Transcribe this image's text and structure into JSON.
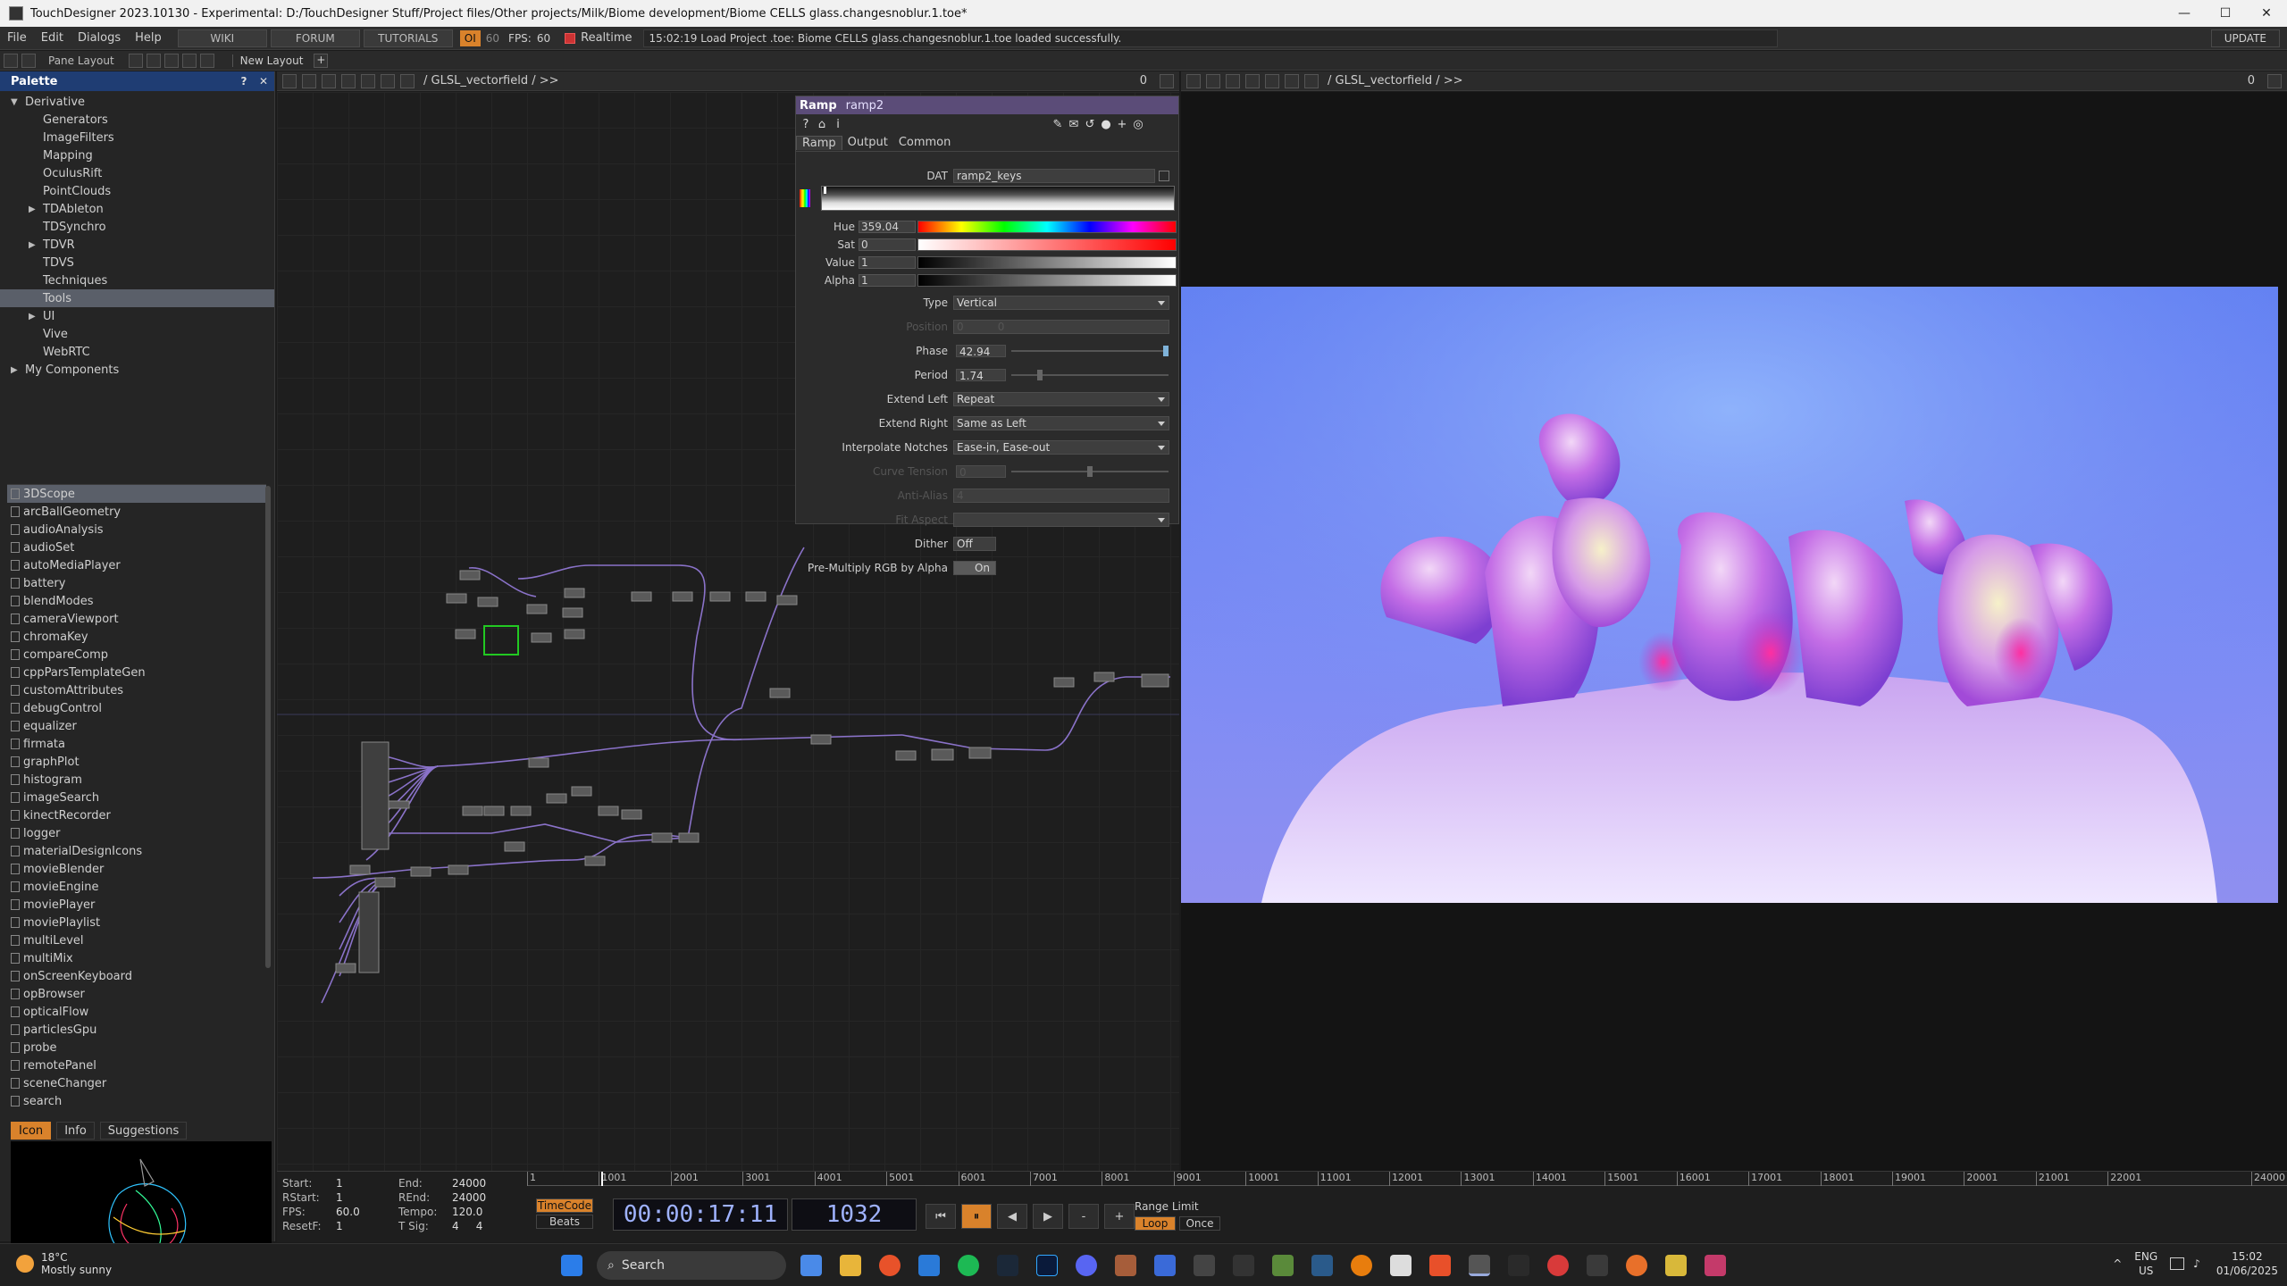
{
  "window": {
    "title": "TouchDesigner 2023.10130 - Experimental: D:/TouchDesigner Stuff/Project files/Other projects/Milk/Biome development/Biome CELLS glass.changesnoblur.1.toe*",
    "minimize": "—",
    "maximize": "☐",
    "close": "✕"
  },
  "menu": {
    "items": [
      "File",
      "Edit",
      "Dialogs",
      "Help"
    ],
    "wiki": "WIKI",
    "forum": "FORUM",
    "tutorials": "TUTORIALS",
    "oi": "OI",
    "fps_small": "60",
    "fps_label": "FPS:",
    "fps_value": "60",
    "realtime": "Realtime",
    "status": "15:02:19 Load Project .toe: Biome CELLS glass.changesnoblur.1.toe loaded successfully.",
    "update": "UPDATE"
  },
  "panebar": {
    "pane_layout": "Pane Layout",
    "new_layout": "New Layout",
    "plus": "+"
  },
  "palette": {
    "title": "Palette",
    "help": "?",
    "close": "✕",
    "tree": [
      {
        "label": "Derivative",
        "indent": 0,
        "arrow": "▼"
      },
      {
        "label": "Generators",
        "indent": 1,
        "arrow": ""
      },
      {
        "label": "ImageFilters",
        "indent": 1,
        "arrow": ""
      },
      {
        "label": "Mapping",
        "indent": 1,
        "arrow": ""
      },
      {
        "label": "OculusRift",
        "indent": 1,
        "arrow": ""
      },
      {
        "label": "PointClouds",
        "indent": 1,
        "arrow": ""
      },
      {
        "label": "TDAbleton",
        "indent": 1,
        "arrow": "▶"
      },
      {
        "label": "TDSynchro",
        "indent": 1,
        "arrow": ""
      },
      {
        "label": "TDVR",
        "indent": 1,
        "arrow": "▶"
      },
      {
        "label": "TDVS",
        "indent": 1,
        "arrow": ""
      },
      {
        "label": "Techniques",
        "indent": 1,
        "arrow": ""
      },
      {
        "label": "Tools",
        "indent": 1,
        "arrow": "",
        "selected": true
      },
      {
        "label": "UI",
        "indent": 1,
        "arrow": "▶"
      },
      {
        "label": "Vive",
        "indent": 1,
        "arrow": ""
      },
      {
        "label": "WebRTC",
        "indent": 1,
        "arrow": ""
      },
      {
        "label": "My Components",
        "indent": 0,
        "arrow": "▶"
      }
    ],
    "tox": [
      "3DScope",
      "arcBallGeometry",
      "audioAnalysis",
      "audioSet",
      "autoMediaPlayer",
      "battery",
      "blendModes",
      "cameraViewport",
      "chromaKey",
      "compareComp",
      "cppParsTemplateGen",
      "customAttributes",
      "debugControl",
      "equalizer",
      "firmata",
      "graphPlot",
      "histogram",
      "imageSearch",
      "kinectRecorder",
      "logger",
      "materialDesignIcons",
      "movieBlender",
      "movieEngine",
      "moviePlayer",
      "moviePlaylist",
      "multiLevel",
      "multiMix",
      "onScreenKeyboard",
      "opBrowser",
      "opticalFlow",
      "particlesGpu",
      "probe",
      "remotePanel",
      "sceneChanger",
      "search"
    ],
    "tabs": [
      "Icon",
      "Info",
      "Suggestions"
    ]
  },
  "network": {
    "left_path": "/ GLSL_vectorfield / >>",
    "right_path": "/ GLSL_vectorfield / >>",
    "left_count": "0",
    "right_count": "0"
  },
  "ramp": {
    "type": "Ramp",
    "name": "ramp2",
    "tabs": [
      "Ramp",
      "Output",
      "Common"
    ],
    "dat_label": "DAT",
    "dat_value": "ramp2_keys",
    "hue_label": "Hue",
    "hue_value": "359.04",
    "sat_label": "Sat",
    "sat_value": "0",
    "value_label": "Value",
    "value_value": "1",
    "alpha_label": "Alpha",
    "alpha_value": "1",
    "params": [
      {
        "label": "Type",
        "value": "Vertical",
        "kind": "select"
      },
      {
        "label": "Position",
        "value": "0          0",
        "dim": true
      },
      {
        "label": "Phase",
        "value": "42.94",
        "slider": 1.0
      },
      {
        "label": "Period",
        "value": "1.74",
        "slider": 0.17
      },
      {
        "label": "Extend Left",
        "value": "Repeat",
        "kind": "select"
      },
      {
        "label": "Extend Right",
        "value": "Same as Left",
        "kind": "select"
      },
      {
        "label": "Interpolate Notches",
        "value": "Ease-in, Ease-out",
        "kind": "select"
      },
      {
        "label": "Curve Tension",
        "value": "0",
        "dim": true,
        "slider": 0.5
      },
      {
        "label": "Anti-Alias",
        "value": "4",
        "dim": true
      },
      {
        "label": "Fit Aspect",
        "value": "",
        "dim": true,
        "kind": "select"
      },
      {
        "label": "Dither",
        "value": "Off",
        "kind": "toggle"
      },
      {
        "label": "Pre-Multiply RGB by Alpha",
        "value": "On",
        "kind": "toggle",
        "on": true
      }
    ]
  },
  "timeline": {
    "start_label": "Start:",
    "start": "1",
    "end_label": "End:",
    "end": "24000",
    "rstart_label": "RStart:",
    "rstart": "1",
    "rend_label": "REnd:",
    "rend": "24000",
    "fps_label": "FPS:",
    "fps": "60.0",
    "tempo_label": "Tempo:",
    "tempo": "120.0",
    "resetf_label": "ResetF:",
    "resetf": "1",
    "tsig_label": "T Sig:",
    "tsig": "4     4",
    "ticks": [
      "1",
      "1001",
      "2001",
      "3001",
      "4001",
      "5001",
      "6001",
      "7001",
      "8001",
      "9001",
      "10001",
      "11001",
      "12001",
      "13001",
      "14001",
      "15001",
      "16001",
      "17001",
      "18001",
      "19001",
      "20001",
      "21001",
      "22001",
      "24000"
    ],
    "playhead_frame": 1032,
    "timecode_btn": "TimeCode",
    "beats_btn": "Beats",
    "timecode": "00:00:17:11",
    "frame": "1032",
    "range_label": "Range Limit",
    "loop": "Loop",
    "once": "Once",
    "btn_rewind": "⏮",
    "btn_pause": "⏸",
    "btn_back": "◀",
    "btn_fwd": "▶",
    "btn_minus": "-",
    "btn_plus": "+"
  },
  "taskbar": {
    "temp": "18°C",
    "weather": "Mostly sunny",
    "search": "Search",
    "lang1": "ENG",
    "lang2": "US",
    "time": "15:02",
    "date": "01/06/2025"
  }
}
